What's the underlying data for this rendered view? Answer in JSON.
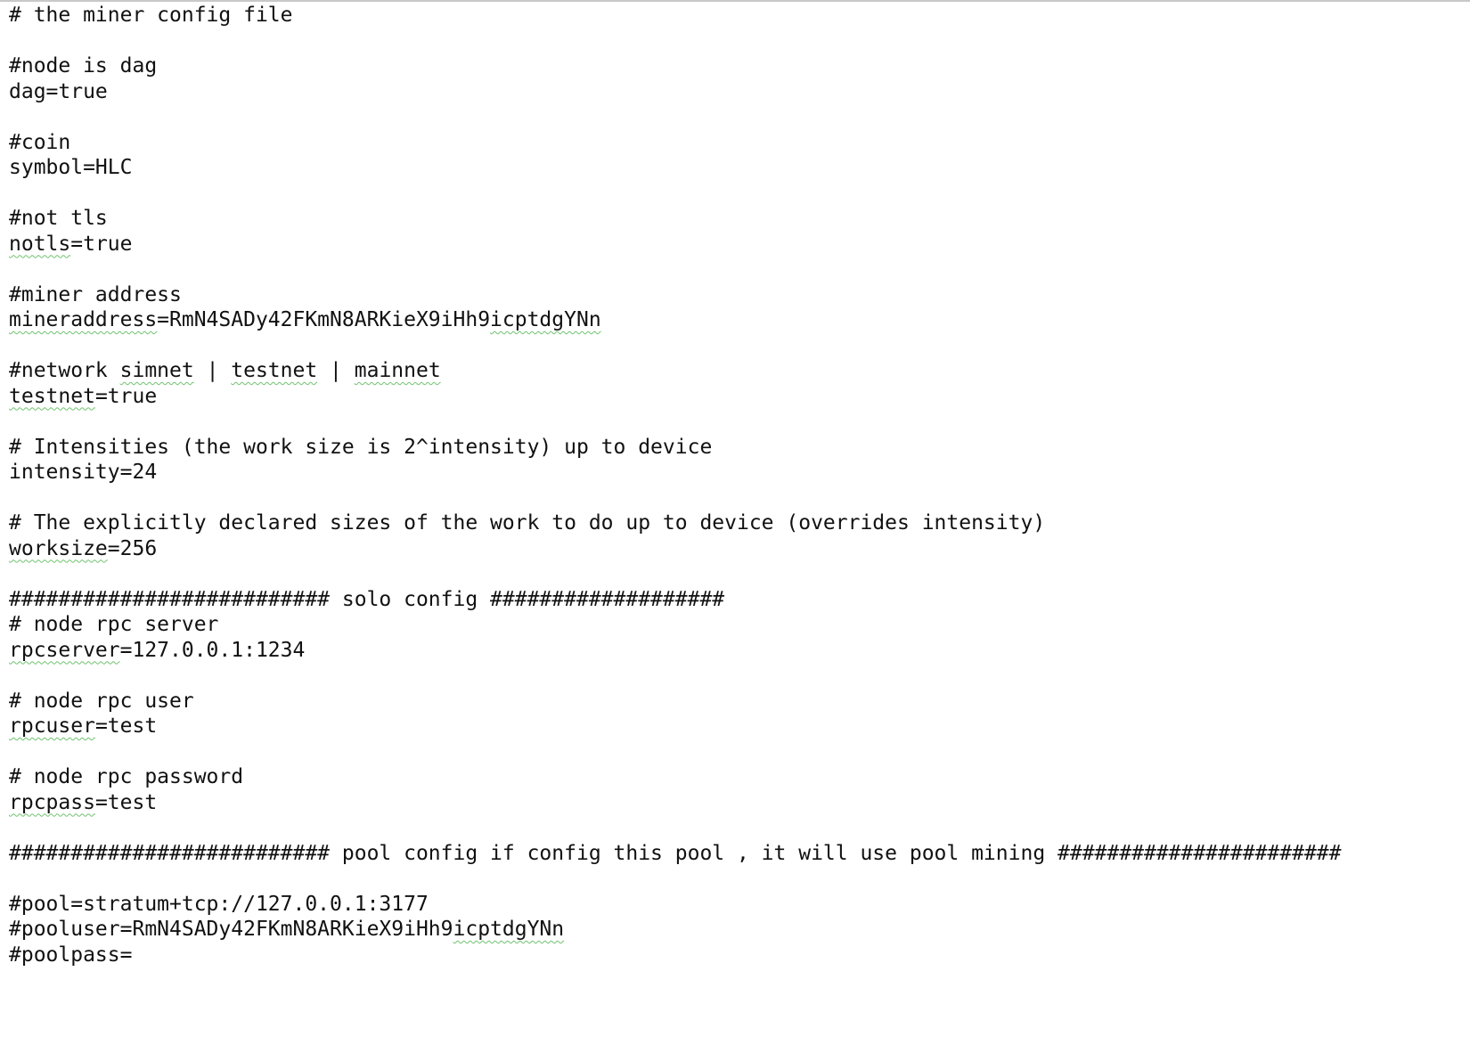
{
  "document": {
    "lines": [
      [
        {
          "t": "# the miner config file"
        }
      ],
      [],
      [
        {
          "t": "#node is dag"
        }
      ],
      [
        {
          "t": "dag=true"
        }
      ],
      [],
      [
        {
          "t": "#coin"
        }
      ],
      [
        {
          "t": "symbol=HLC"
        }
      ],
      [],
      [
        {
          "t": "#not tls"
        }
      ],
      [
        {
          "t": "notls",
          "sp": true
        },
        {
          "t": "=true"
        }
      ],
      [],
      [
        {
          "t": "#miner address"
        }
      ],
      [
        {
          "t": "mineraddress",
          "sp": true
        },
        {
          "t": "=RmN4SADy42FKmN8ARKieX9iHh9"
        },
        {
          "t": "icptdgYNn",
          "sp": true
        }
      ],
      [],
      [
        {
          "t": "#network "
        },
        {
          "t": "simnet",
          "sp": true
        },
        {
          "t": " | "
        },
        {
          "t": "testnet",
          "sp": true
        },
        {
          "t": " | "
        },
        {
          "t": "mainnet",
          "sp": true
        }
      ],
      [
        {
          "t": "testnet",
          "sp": true
        },
        {
          "t": "=true"
        }
      ],
      [],
      [
        {
          "t": "# Intensities (the work size is 2^intensity) up to device"
        }
      ],
      [
        {
          "t": "intensity=24"
        }
      ],
      [],
      [
        {
          "t": "# The explicitly declared sizes of the work to do up to device (overrides intensity)"
        }
      ],
      [
        {
          "t": "worksize",
          "sp": true
        },
        {
          "t": "=256"
        }
      ],
      [],
      [
        {
          "t": "########################## solo config ###################"
        }
      ],
      [
        {
          "t": "# node rpc server"
        }
      ],
      [
        {
          "t": "rpcserver",
          "sp": true
        },
        {
          "t": "=127.0.0.1:1234"
        }
      ],
      [],
      [
        {
          "t": "# node rpc user"
        }
      ],
      [
        {
          "t": "rpcuser",
          "sp": true
        },
        {
          "t": "=test"
        }
      ],
      [],
      [
        {
          "t": "# node rpc password"
        }
      ],
      [
        {
          "t": "rpcpass",
          "sp": true
        },
        {
          "t": "=test"
        }
      ],
      [],
      [
        {
          "t": "########################## pool config if config this pool , it will use pool mining #######################"
        }
      ],
      [],
      [
        {
          "t": "#pool=stratum+tcp://127.0.0.1:3177"
        }
      ],
      [
        {
          "t": "#pooluser=RmN4SADy42FKmN8ARKieX9iHh9"
        },
        {
          "t": "icptdgYNn",
          "sp": true
        }
      ],
      [
        {
          "t": "#poolpass="
        }
      ]
    ]
  }
}
